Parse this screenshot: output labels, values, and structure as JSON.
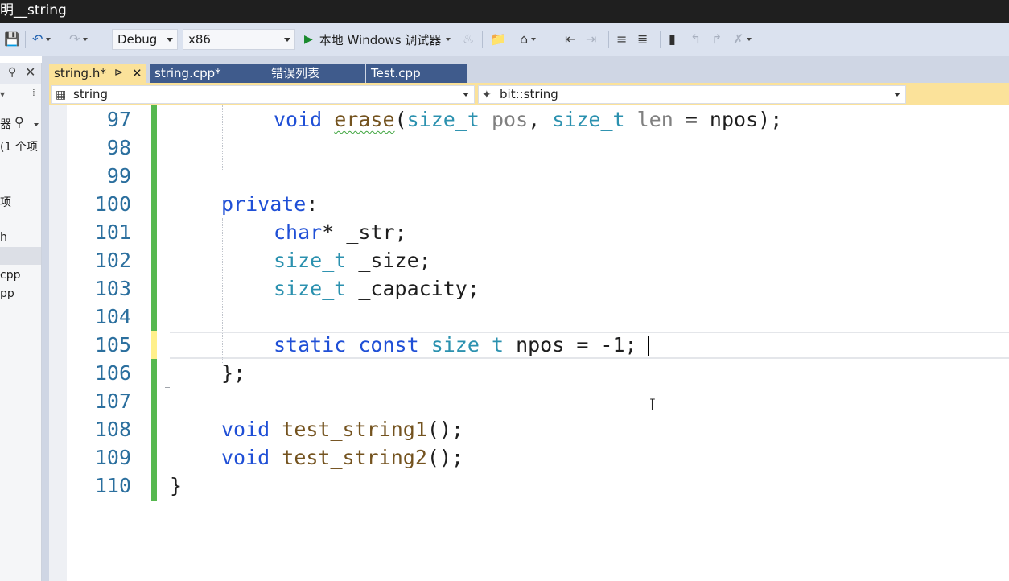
{
  "title_bar": {
    "title": "明__string"
  },
  "toolbar": {
    "config": "Debug",
    "platform": "x86",
    "run_label": "本地 Windows 调试器"
  },
  "left_pane": {
    "lines": [
      "器",
      "(1 个项",
      "项",
      "h",
      "cpp",
      "pp"
    ]
  },
  "tabs": [
    {
      "label": "string.h*",
      "active": true
    },
    {
      "label": "string.cpp*",
      "active": false
    },
    {
      "label": "错误列表",
      "active": false
    },
    {
      "label": "Test.cpp",
      "active": false
    }
  ],
  "navbar": {
    "scope": "string",
    "member": "bit::string"
  },
  "editor": {
    "line_numbers": [
      "97",
      "98",
      "99",
      "100",
      "101",
      "102",
      "103",
      "104",
      "105",
      "106",
      "107",
      "108",
      "109",
      "110"
    ],
    "code": {
      "l97": {
        "t1": "void",
        "t2": "erase",
        "t3": "(",
        "t4": "size_t",
        "t5": " pos",
        "t6": ", ",
        "t7": "size_t",
        "t8": " len",
        "t9": " = npos);"
      },
      "l100": {
        "t1": "private",
        "t2": ":"
      },
      "l101": {
        "t1": "char",
        "t2": "* _str;"
      },
      "l102": {
        "t1": "size_t",
        "t2": " _size;"
      },
      "l103": {
        "t1": "size_t",
        "t2": " _capacity;"
      },
      "l105": {
        "t1": "static",
        "t2": " ",
        "t3": "const",
        "t4": " ",
        "t5": "size_t",
        "t6": " npos = -1;"
      },
      "l106": {
        "t1": "};"
      },
      "l108": {
        "t1": "void",
        "t2": " ",
        "t3": "test_string1",
        "t4": "();"
      },
      "l109": {
        "t1": "void",
        "t2": " ",
        "t3": "test_string2",
        "t4": "();"
      },
      "l110": {
        "t1": "}"
      }
    },
    "cursor_glyph": "I"
  },
  "colors": {
    "keyword": "#1f4fd6",
    "type": "#2b91af",
    "function": "#74531f",
    "parameter": "#808080",
    "line_number": "#2b6f9e",
    "change_margin_saved": "#56b84f",
    "change_margin_unsaved": "#fff08a",
    "active_tab": "#fbe29a",
    "inactive_tab": "#3f5b8c"
  }
}
